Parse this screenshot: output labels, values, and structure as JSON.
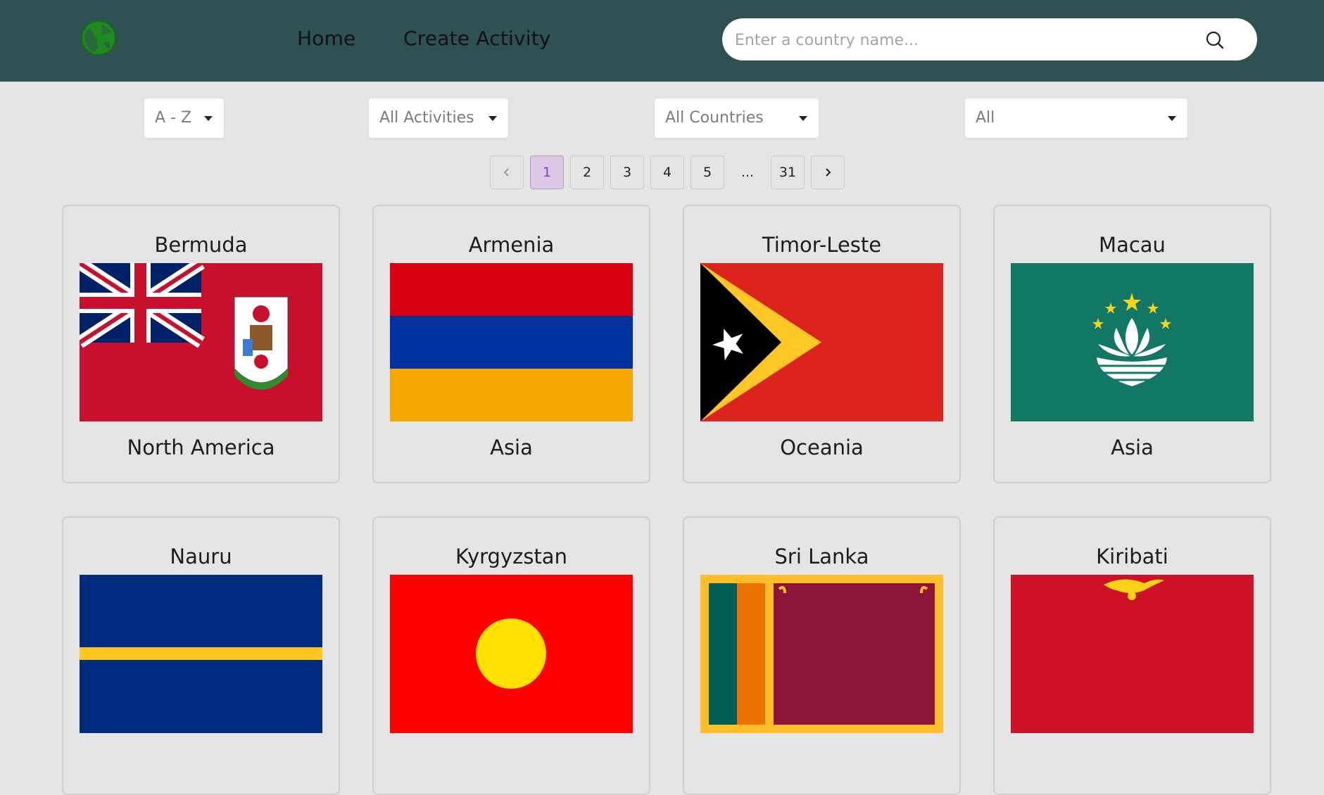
{
  "header": {
    "nav": {
      "home": "Home",
      "create_activity": "Create Activity"
    },
    "search": {
      "placeholder": "Enter a country name..."
    },
    "logo_icon": "globe-icon",
    "search_icon": "search-icon"
  },
  "filters": {
    "order": "A - Z",
    "activity": "All Activities",
    "countries": "All Countries",
    "continent": "All"
  },
  "pagination": {
    "prev_icon": "chevron-left-icon",
    "next_icon": "chevron-right-icon",
    "pages": [
      "1",
      "2",
      "3",
      "4",
      "5"
    ],
    "ellipsis": "...",
    "last": "31",
    "current": "1"
  },
  "countries": [
    {
      "name": "Bermuda",
      "continent": "North America"
    },
    {
      "name": "Armenia",
      "continent": "Asia"
    },
    {
      "name": "Timor-Leste",
      "continent": "Oceania"
    },
    {
      "name": "Macau",
      "continent": "Asia"
    },
    {
      "name": "Nauru"
    },
    {
      "name": "Kyrgyzstan"
    },
    {
      "name": "Sri Lanka"
    },
    {
      "name": "Kiribati"
    }
  ],
  "colors": {
    "header_bg": "#2f5151",
    "page_bg": "#e4e4e4",
    "logo_green": "#1f8a1f",
    "active_page_bg": "#dcc7e6",
    "active_page_text": "#8a3fb0"
  }
}
